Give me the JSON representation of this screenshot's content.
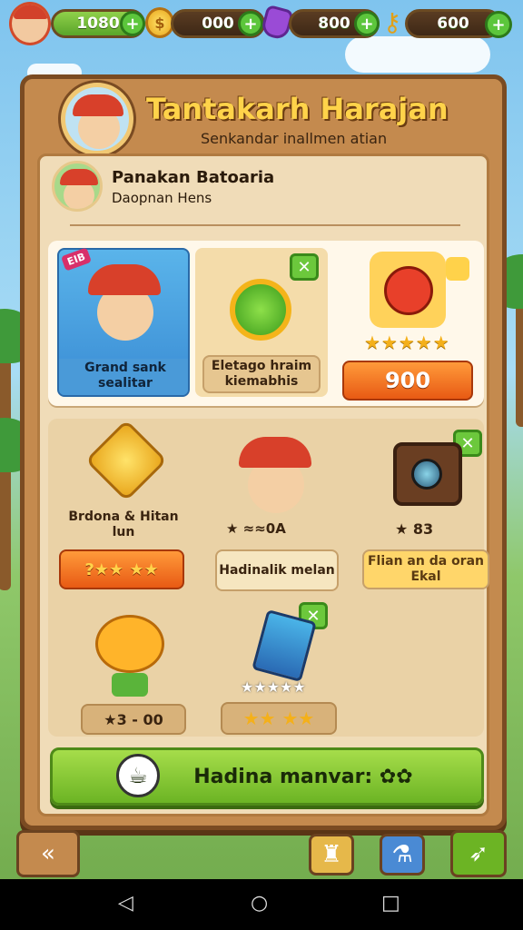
{
  "top_bar": {
    "resource_1": "1080",
    "resource_2": "000",
    "resource_3": "800",
    "resource_4": "600"
  },
  "header": {
    "title": "Tantakarh Harajan",
    "subtitle": "Senkandar inallmen atian"
  },
  "profile": {
    "name": "Panakan Batoaria",
    "subtitle": "Daopnan Hens"
  },
  "featured": {
    "card1": {
      "badge": "EIB",
      "label": "Grand sank sealitar"
    },
    "card2": {
      "label": "Eletago hraim kiemabhis"
    },
    "card3": {
      "stars": "★★★★★",
      "price": "900"
    }
  },
  "items": {
    "item1": {
      "label": "Brdona & Hitan lun",
      "button": "?★★ ★★"
    },
    "item2": {
      "rating": "★ ≈≈0A",
      "button": "Hadinalik melan"
    },
    "item3": {
      "rating": "★ 83",
      "button": "Flian an da oran Ekal"
    },
    "item4": {
      "price": "★3 - 00"
    },
    "item5": {
      "stars": "★★★★★",
      "button": "★★ ★★"
    }
  },
  "main_button": {
    "label": "Hadina manvar: ✿✿"
  },
  "colors": {
    "accent_green": "#6cb424",
    "accent_orange": "#e85a14",
    "wood": "#c48a4e"
  }
}
